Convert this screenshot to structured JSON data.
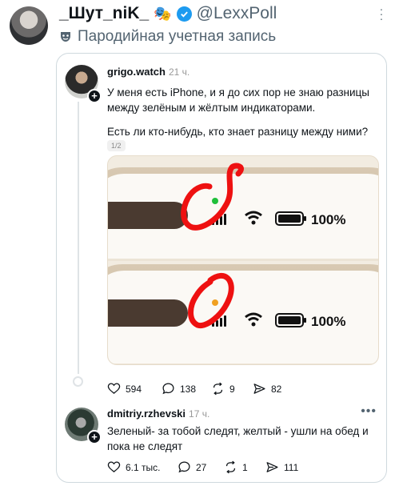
{
  "author": {
    "name": "_Шут_niK_",
    "handle": "@LexxPoll",
    "parody_label": "Пародийная учетная запись",
    "verified_color": "#1d9bf0"
  },
  "quoted_post": {
    "username": "grigo.watch",
    "time": "21 ч.",
    "text_1": "У меня есть iPhone, и я до сих пор не знаю разницы между зелёным и жёлтым индикаторами.",
    "text_2": "Есть ли кто-нибудь, кто знает разницу между ними?",
    "page_indicator": "1/2",
    "image": {
      "battery_label": "100%",
      "top_indicator_color": "#1fbf3a",
      "bottom_indicator_color": "#f0a020",
      "annotation_color": "#ee1111"
    },
    "actions": {
      "likes": "594",
      "comments": "138",
      "reposts": "9",
      "shares": "82"
    }
  },
  "reply": {
    "username": "dmitriy.rzhevski",
    "time": "17 ч.",
    "text": "Зеленый- за тобой следят, желтый - ушли на обед и пока не следят",
    "actions": {
      "likes": "6.1 тыс.",
      "comments": "27",
      "reposts": "1",
      "shares": "111"
    }
  }
}
